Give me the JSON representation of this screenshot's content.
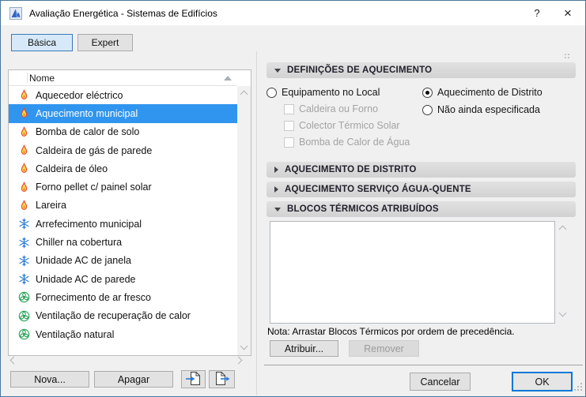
{
  "window": {
    "title": "Avaliação Energética - Sistemas de Edifícios",
    "help_glyph": "?",
    "close_glyph": "×"
  },
  "tabs": [
    {
      "label": "Básica",
      "active": true
    },
    {
      "label": "Expert",
      "active": false
    }
  ],
  "list": {
    "header": "Nome",
    "items": [
      {
        "label": "Aquecedor eléctrico",
        "icon": "flame",
        "selected": false
      },
      {
        "label": "Aquecimento municipal",
        "icon": "flame",
        "selected": true
      },
      {
        "label": "Bomba de calor de solo",
        "icon": "flame",
        "selected": false
      },
      {
        "label": "Caldeira de gás de parede",
        "icon": "flame",
        "selected": false
      },
      {
        "label": "Caldeira de óleo",
        "icon": "flame",
        "selected": false
      },
      {
        "label": "Forno pellet c/ painel solar",
        "icon": "flame",
        "selected": false
      },
      {
        "label": "Lareira",
        "icon": "flame",
        "selected": false
      },
      {
        "label": "Arrefecimento municipal",
        "icon": "snowflake",
        "selected": false
      },
      {
        "label": "Chiller na cobertura",
        "icon": "snowflake",
        "selected": false
      },
      {
        "label": "Unidade AC de janela",
        "icon": "snowflake",
        "selected": false
      },
      {
        "label": "Unidade AC de parede",
        "icon": "snowflake",
        "selected": false
      },
      {
        "label": "Fornecimento de ar fresco",
        "icon": "fan",
        "selected": false
      },
      {
        "label": "Ventilação de recuperação de calor",
        "icon": "fan",
        "selected": false
      },
      {
        "label": "Ventilação natural",
        "icon": "fan",
        "selected": false
      }
    ]
  },
  "panel": {
    "sections": [
      {
        "title": "DEFINIÇÕES DE AQUECIMENTO",
        "expanded": true
      },
      {
        "title": "AQUECIMENTO DE DISTRITO",
        "expanded": false
      },
      {
        "title": "AQUECIMENTO SERVIÇO ÁGUA-QUENTE",
        "expanded": false
      },
      {
        "title": "BLOCOS TÉRMICOS ATRIBUÍDOS",
        "expanded": true
      }
    ],
    "heating_options": {
      "local": {
        "label": "Equipamento no Local",
        "selected": false
      },
      "district": {
        "label": "Aquecimento de Distrito",
        "selected": true
      },
      "unspecified": {
        "label": "Não ainda especificada",
        "selected": false
      },
      "sub_checkboxes": [
        {
          "label": "Caldeira ou Forno",
          "checked": false,
          "disabled": true
        },
        {
          "label": "Colector Térmico Solar",
          "checked": false,
          "disabled": true
        },
        {
          "label": "Bomba de Calor de Água",
          "checked": false,
          "disabled": true
        }
      ]
    },
    "assigned_blocks": {
      "note": "Nota: Arrastar Blocos Térmicos por ordem de precedência.",
      "assign_label": "Atribuir...",
      "remove_label": "Remover",
      "remove_disabled": true,
      "items": []
    }
  },
  "footer": {
    "new_label": "Nova...",
    "delete_label": "Apagar",
    "cancel_label": "Cancelar",
    "ok_label": "OK"
  },
  "colors": {
    "selection": "#3095ee",
    "ok_focus_border": "#0078d7",
    "window_border": "#49759a",
    "flame": "#e2492f",
    "snowflake": "#2e7dd8",
    "fan": "#22a353"
  }
}
